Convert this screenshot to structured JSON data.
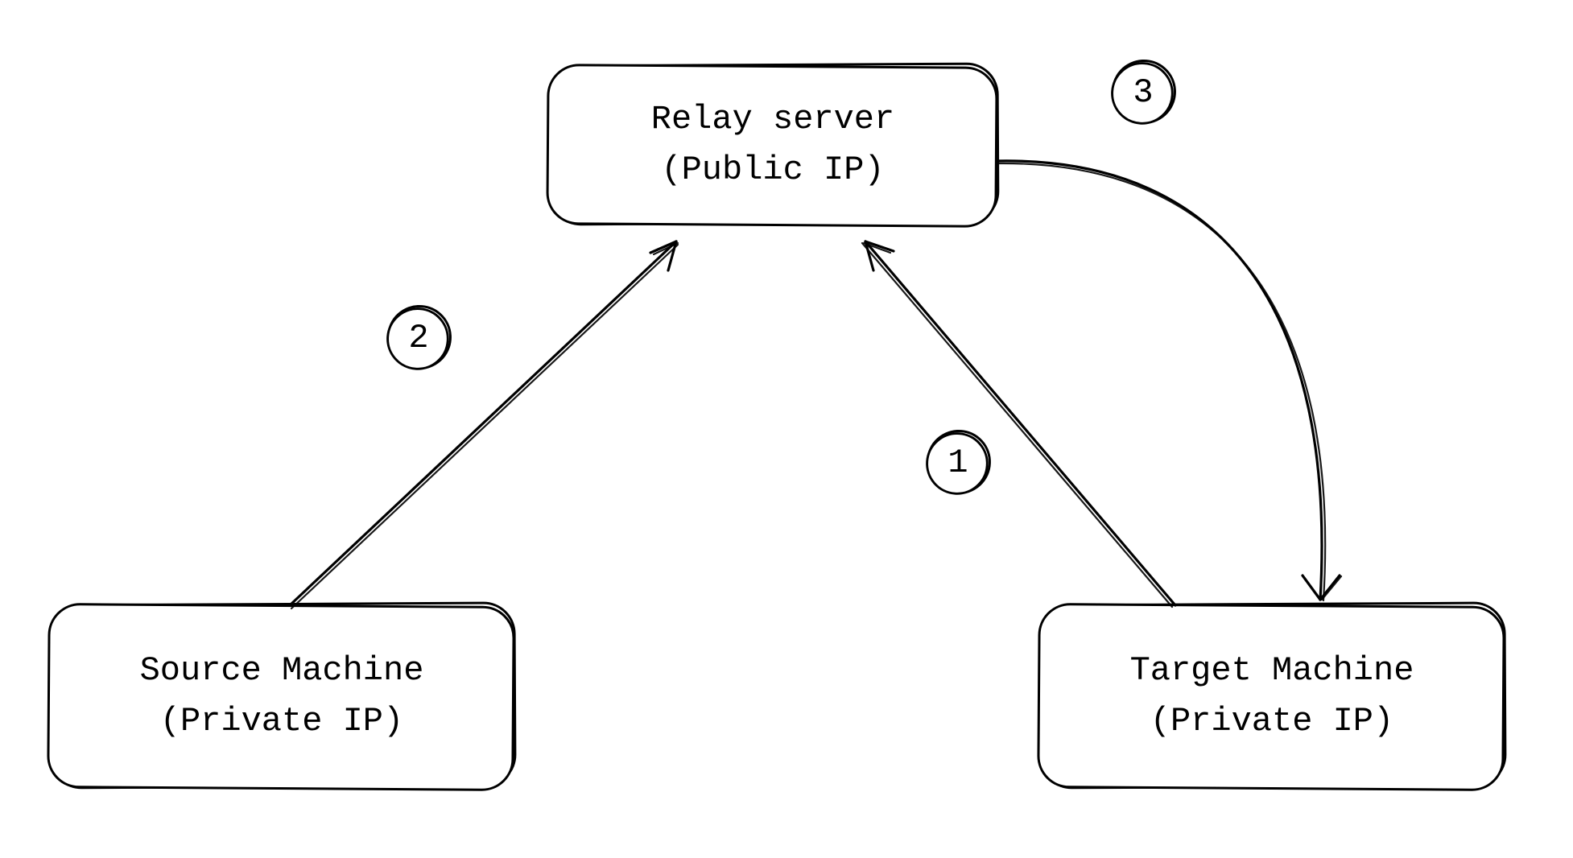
{
  "nodes": {
    "relay": {
      "title": "Relay server",
      "subtitle": "(Public IP)"
    },
    "source": {
      "title": "Source Machine",
      "subtitle": "(Private IP)"
    },
    "target": {
      "title": "Target Machine",
      "subtitle": "(Private IP)"
    }
  },
  "steps": {
    "s1": "1",
    "s2": "2",
    "s3": "3"
  },
  "edges": [
    {
      "id": "arrow-1",
      "from": "target",
      "to": "relay",
      "step": "s1",
      "direction": "up"
    },
    {
      "id": "arrow-2",
      "from": "source",
      "to": "relay",
      "step": "s2",
      "direction": "up"
    },
    {
      "id": "arrow-3",
      "from": "relay",
      "to": "target",
      "step": "s3",
      "direction": "down-curve"
    }
  ]
}
